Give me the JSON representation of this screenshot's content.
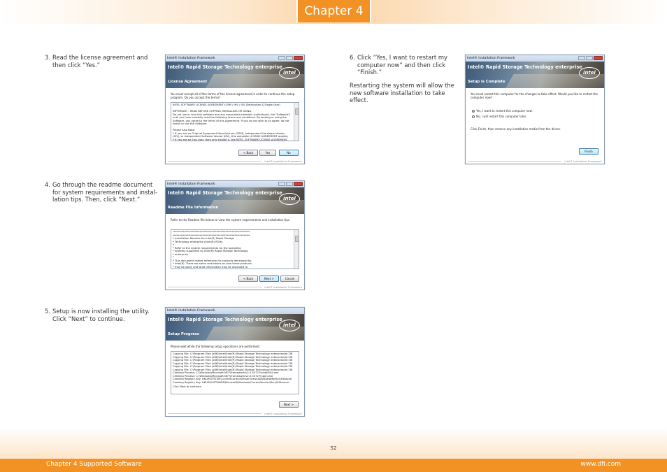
{
  "header": {
    "chapter": "Chapter 4"
  },
  "steps": [
    {
      "num": "3.",
      "lines": [
        "Read the license agreement and",
        "then click “Yes.”"
      ]
    },
    {
      "num": "4.",
      "lines": [
        "Go through the readme document",
        "for system requirements and instal-",
        "lation tips. Then, click “Next.”"
      ]
    },
    {
      "num": "5.",
      "lines": [
        "Setup is now installing the utility.",
        "Click “Next” to continue."
      ]
    },
    {
      "num": "6.",
      "lines": [
        "Click “Yes, I want to restart my",
        "computer now” and then click",
        "“Finish.”"
      ]
    }
  ],
  "restart_note": [
    "Restarting the system will allow the",
    "new software installation to take",
    "effect."
  ],
  "common": {
    "window_title": "Intel® Installation Framework",
    "product": "Intel® Rapid Storage Technology enterprise",
    "logo": "intel",
    "footer": "Intel® Installation Framework"
  },
  "license_window": {
    "section": "License Agreement",
    "intro": "You must accept all of the terms of the license agreement in order to continue the setup program. Do you accept the terms?",
    "text": [
      "INTEL SOFTWARE LICENSE AGREEMENT (OEM / IHV / ISV Distribution & Single User)",
      "",
      "IMPORTANT - READ BEFORE COPYING, INSTALLING OR USING.",
      "Do not use or load this software and any associated materials (collectively, the \"Software\")",
      "until you have carefully read the following terms and conditions. By loading or using the",
      "Software, you agree to the terms of this Agreement. If you do not wish to so agree, do not",
      "install or use the Software.",
      "",
      "Please Also Note:",
      "* If you are an Original Equipment Manufacturer (OEM), Independent Hardware Vendor",
      "(IHV), or Independent Software Vendor (ISV), this complete LICENSE AGREEMENT applies;",
      "* If you are an End-User, then only Exhibit A, the INTEL SOFTWARE LICENSE AGREEMENT,"
    ],
    "buttons": {
      "back": "< Back",
      "yes": "Yes",
      "no": "No"
    }
  },
  "readme_window": {
    "section": "Readme File Information",
    "intro": "Refer to the Readme file below to view the system requirements and installation tips.",
    "text": [
      "************************************************************",
      "************************************************************",
      "*  Installation Readme for Intel(R) Rapid Storage",
      "*  Technology enterprise (Intel(R) RSTe).",
      "*",
      "*  Refer to the system requirements for the operating",
      "*  systems supported by Intel(R) Rapid Storage Technology",
      "*  enterprise.",
      "*",
      "*  This document makes references to products developed by",
      "*  Intel(R). There are some restrictions on how these products",
      "*  may be used, and what information may be disclosed to"
    ],
    "buttons": {
      "back": "< Back",
      "next": "Next >",
      "cancel": "Cancel"
    }
  },
  "progress_window": {
    "section": "Setup Progress",
    "intro": "Please wait while the following setup operations are performed:",
    "text": [
      "Copying File: C:\\Program Files (x86)\\Intel\\Intel(R) Rapid Storage Technology enterprise\\zh-TW",
      "Copying File: C:\\Program Files (x86)\\Intel\\Intel(R) Rapid Storage Technology enterprise\\zh-TW",
      "Copying File: C:\\Program Files (x86)\\Intel\\Intel(R) Rapid Storage Technology enterprise\\zh-TW",
      "Copying File: C:\\Program Files (x86)\\Intel\\Intel(R) Rapid Storage Technology enterprise\\zh-TW",
      "Copying File: C:\\Program Files (x86)\\Intel\\Intel(R) Rapid Storage Technology enterprise\\zh-TW",
      "Copying File: C:\\Program Files (x86)\\Intel\\Intel(R) Rapid Storage Technology enterprise\\zh-TW",
      "Creating Process: C:\\Windows\\Microsoft.NET\\Framework\\v2.0.50727\\InstallUtil.exe",
      "Creating Process: C:\\Windows\\Microsoft.NET\\Framework\\v2.0.50727\\ngen.exe",
      "Creating Registry Key: HKLM\\SYSTEM\\CurrentControlSet\\services\\iaStorDataMgrSvc\\Delayed",
      "Creating Registry Key: HKLM\\SOFTWARE\\Microsoft\\Windows\\CurrentVersion\\Run\\IAStorIcon",
      "",
      "Click Next to continue."
    ],
    "buttons": {
      "next": "Next >"
    }
  },
  "complete_window": {
    "section": "Setup Is Complete",
    "intro": "You must restart this computer for the changes to take effect. Would you like to restart the computer now?",
    "option_yes": "Yes, I want to restart this computer now.",
    "option_no": "No, I will restart this computer later.",
    "note": "Click Finish, then remove any installation media from the drives.",
    "buttons": {
      "finish": "Finish"
    }
  },
  "page_number": "52",
  "footer": {
    "left": "Chapter 4 Supported Software",
    "right": "www.dfi.com"
  }
}
